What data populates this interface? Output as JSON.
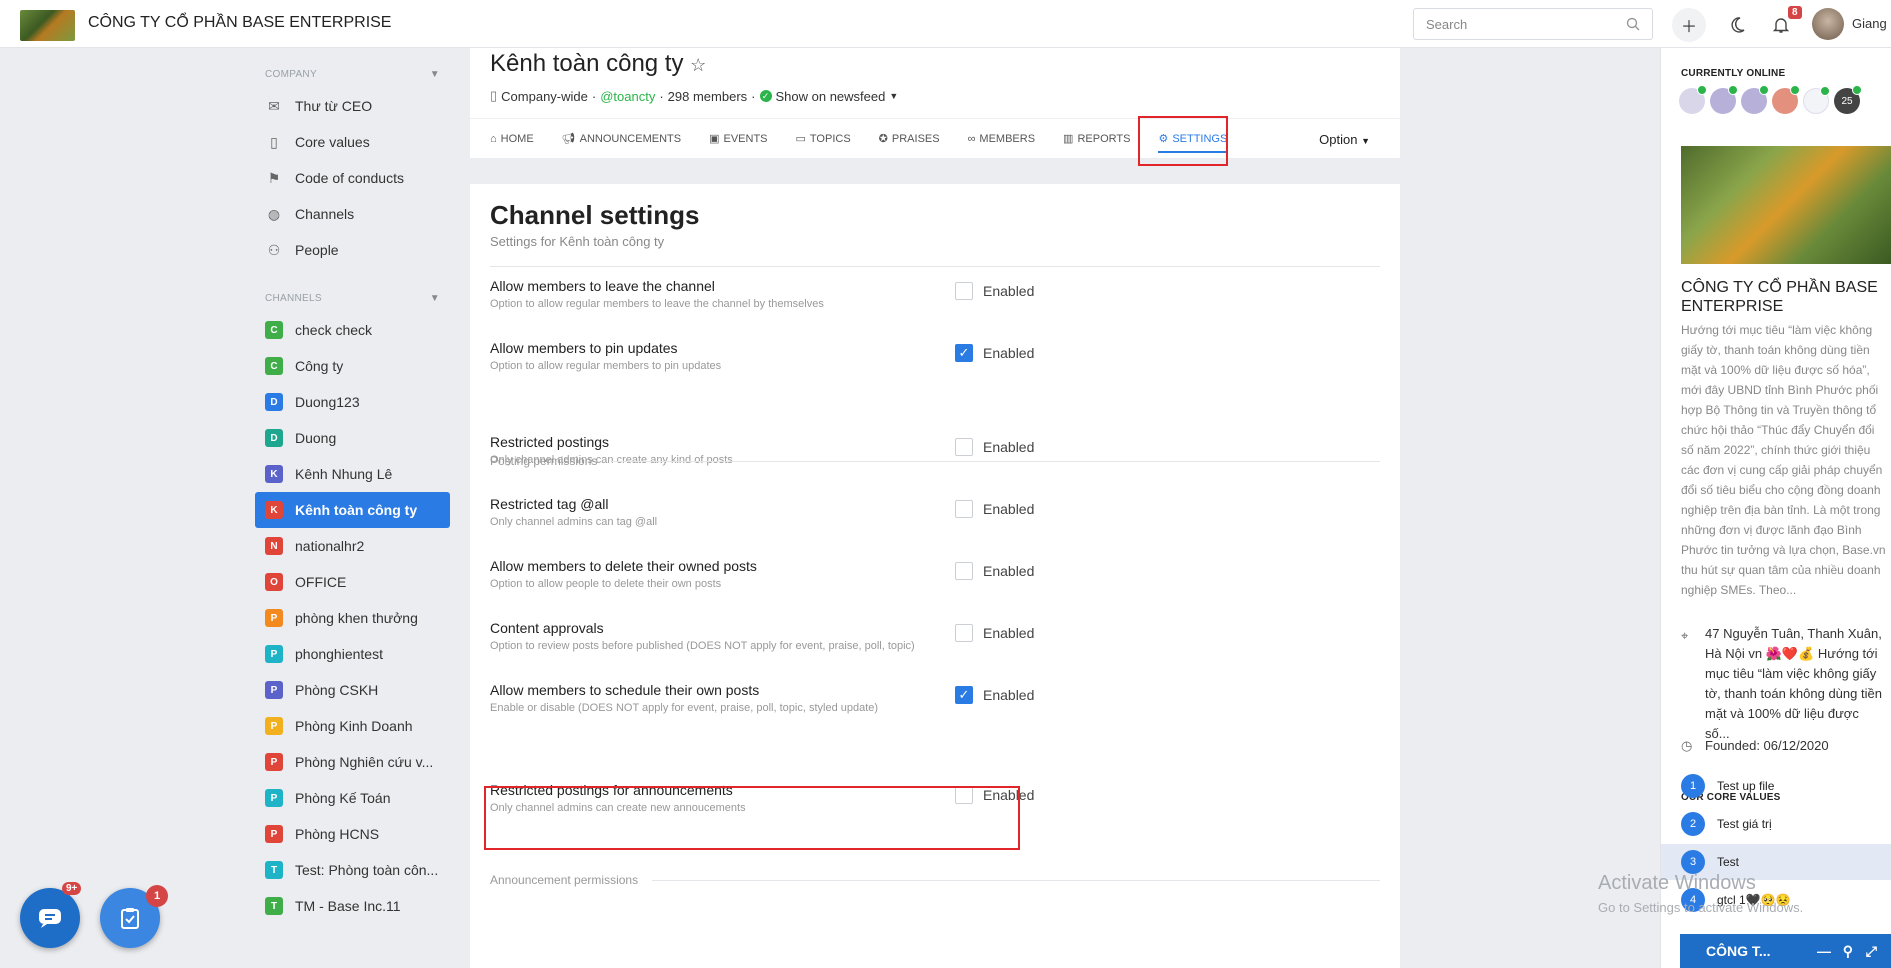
{
  "topbar": {
    "company": "CÔNG TY CỔ PHẦN BASE ENTERPRISE",
    "search_placeholder": "Search",
    "notif_count": "8",
    "username": "Giang"
  },
  "sidebar": {
    "company_header": "COMPANY",
    "company_items": [
      {
        "label": "Thư từ CEO",
        "icon": "mail-icon"
      },
      {
        "label": "Core values",
        "icon": "book-icon"
      },
      {
        "label": "Code of conducts",
        "icon": "flag-icon"
      },
      {
        "label": "Channels",
        "icon": "globe-icon"
      },
      {
        "label": "People",
        "icon": "people-icon"
      }
    ],
    "channels_header": "CHANNELS",
    "channels": [
      {
        "letter": "C",
        "label": "check check",
        "color": "#3fae49"
      },
      {
        "letter": "C",
        "label": "Công ty",
        "color": "#3fae49"
      },
      {
        "letter": "D",
        "label": "Duong123",
        "color": "#2b7be4"
      },
      {
        "letter": "D",
        "label": "Duong",
        "color": "#1fa68f"
      },
      {
        "letter": "K",
        "label": "Kênh Nhung Lê",
        "color": "#5b62c9"
      },
      {
        "letter": "K",
        "label": "Kênh toàn công ty",
        "color": "#e0453a"
      },
      {
        "letter": "N",
        "label": "nationalhr2",
        "color": "#e0453a"
      },
      {
        "letter": "O",
        "label": "OFFICE",
        "color": "#e0453a"
      },
      {
        "letter": "P",
        "label": "phòng khen thưởng",
        "color": "#f28a1f"
      },
      {
        "letter": "P",
        "label": "phonghientest",
        "color": "#1fb3c8"
      },
      {
        "letter": "P",
        "label": "Phòng CSKH",
        "color": "#5b62c9"
      },
      {
        "letter": "P",
        "label": "Phòng Kinh Doanh",
        "color": "#f2b01f"
      },
      {
        "letter": "P",
        "label": "Phòng Nghiên cứu v...",
        "color": "#e0453a"
      },
      {
        "letter": "P",
        "label": "Phòng Kế Toán",
        "color": "#1fb3c8"
      },
      {
        "letter": "P",
        "label": "Phòng HCNS",
        "color": "#e0453a"
      },
      {
        "letter": "T",
        "label": "Test: Phòng toàn côn...",
        "color": "#1fb3c8"
      },
      {
        "letter": "T",
        "label": "TM - Base Inc.11",
        "color": "#3fae49"
      }
    ],
    "chat_badge": "9+",
    "task_badge": "1"
  },
  "channel": {
    "title": "Kênh toàn công ty",
    "scope": "Company-wide",
    "handle": "@toancty",
    "members": "298 members",
    "newsfeed": "Show on newsfeed",
    "tabs": [
      "HOME",
      "ANNOUNCEMENTS",
      "EVENTS",
      "TOPICS",
      "PRAISES",
      "MEMBERS",
      "REPORTS",
      "SETTINGS"
    ],
    "option": "Option"
  },
  "settings": {
    "title": "Channel settings",
    "subtitle": "Settings for Kênh toàn công ty",
    "enabled_label": "Enabled",
    "rows": [
      {
        "title": "Allow members to leave the channel",
        "desc": "Option to allow regular members to leave the channel by themselves",
        "checked": false
      },
      {
        "title": "Allow members to pin updates",
        "desc": "Option to allow regular members to pin updates",
        "checked": true
      },
      {
        "title": "Restricted postings",
        "desc": "Only channel admins can create any kind of posts",
        "checked": false
      },
      {
        "title": "Restricted tag @all",
        "desc": "Only channel admins can tag @all",
        "checked": false
      },
      {
        "title": "Allow members to delete their owned posts",
        "desc": "Option to allow people to delete their own posts",
        "checked": false
      },
      {
        "title": "Content approvals",
        "desc": "Option to review posts before published (DOES NOT apply for event, praise, poll, topic)",
        "checked": false
      },
      {
        "title": "Allow members to schedule their own posts",
        "desc": "Enable or disable (DOES NOT apply for event, praise, poll, topic, styled update)",
        "checked": true
      },
      {
        "title": "Restricted postings for announcements",
        "desc": "Only channel admins can create new annoucements",
        "checked": false
      }
    ],
    "posting_section": "Posting permissions",
    "announcement_section": "Announcement permissions"
  },
  "right": {
    "online_header": "CURRENTLY ONLINE",
    "online_more": "25",
    "company_name": "CÔNG TY CỔ PHẦN BASE ENTERPRISE",
    "description": "Hướng tới mục tiêu “làm việc không giấy tờ, thanh toán không dùng tiền mặt và 100% dữ liệu được số hóa”, mới đây UBND tỉnh Bình Phước phối hợp Bộ Thông tin và Truyền thông tổ chức hội thảo “Thúc đẩy Chuyển đổi số năm 2022”, chính thức giới thiệu các đơn vị cung cấp giải pháp chuyển đổi số tiêu biểu cho cộng đồng doanh nghiệp trên địa bàn tỉnh. Là một trong những đơn vị được lãnh đạo Bình Phước tin tưởng và lựa chọn, Base.vn thu hút sự quan tâm của nhiều doanh nghiệp SMEs. Theo...",
    "address": "47 Nguyễn Tuân, Thanh Xuân, Hà Nội vn 🌺❤️💰 Hướng tới mục tiêu “làm việc không giấy tờ, thanh toán không dùng tiền mặt và 100% dữ liệu được số...",
    "founded": "Founded: 06/12/2020",
    "core_header": "OUR CORE VALUES",
    "core_values": [
      {
        "n": "1",
        "label": "Test up file"
      },
      {
        "n": "2",
        "label": "Test giá trị"
      },
      {
        "n": "3",
        "label": "Test"
      },
      {
        "n": "4",
        "label": "gtcl 1🖤🥺😣"
      }
    ],
    "chat_bar": "CÔNG T..."
  },
  "watermark": {
    "line1": "Activate Windows",
    "line2": "Go to Settings to activate Windows."
  }
}
